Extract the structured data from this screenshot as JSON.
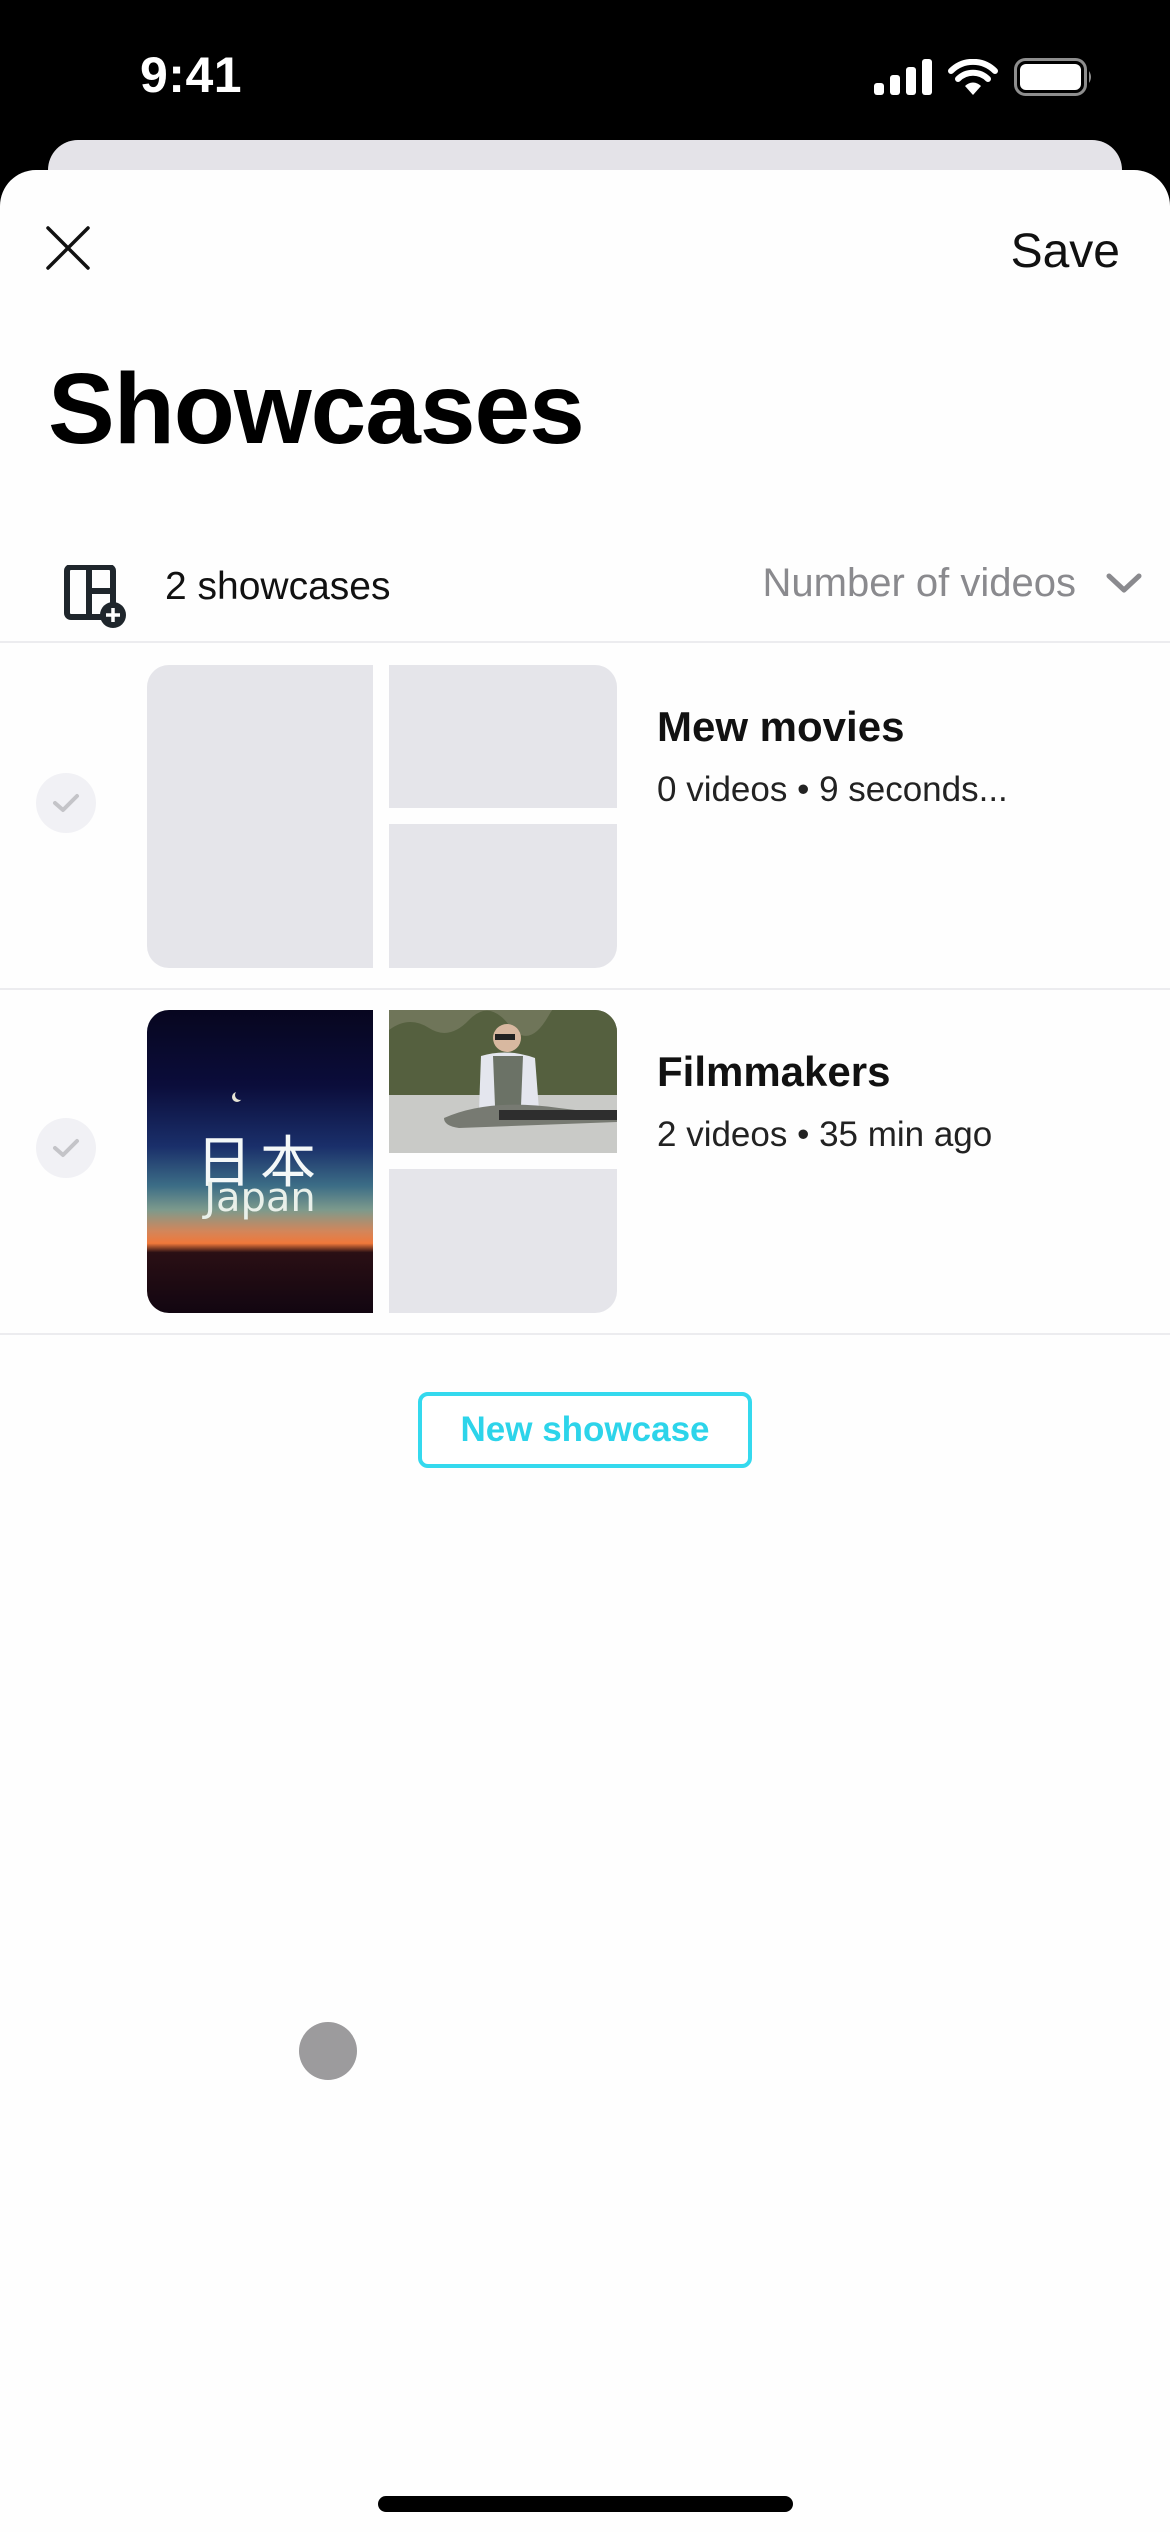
{
  "status_bar": {
    "time": "9:41",
    "icons": [
      "cellular-signal-icon",
      "wifi-icon",
      "battery-icon"
    ]
  },
  "header": {
    "close_icon": "close-icon",
    "save_label": "Save",
    "title": "Showcases"
  },
  "toolbar": {
    "count_icon": "showcase-add-icon",
    "count_label": "2 showcases",
    "sort": {
      "selected": "Number of videos",
      "icon": "chevron-down-icon"
    }
  },
  "showcases": [
    {
      "title": "Mew movies",
      "meta": "0 videos • 9 seconds...",
      "selected": false,
      "thumbnails": [
        "empty",
        "empty",
        "empty"
      ]
    },
    {
      "title": "Filmmakers",
      "meta": "2 videos • 35 min ago",
      "selected": false,
      "thumbnails": [
        "japan-sunset",
        "fisherman-with-fish",
        "empty"
      ],
      "thumbnail_text": {
        "kanji": "日本",
        "english": "Japan"
      }
    }
  ],
  "new_showcase_label": "New showcase",
  "colors": {
    "accent": "#2dd4ea",
    "placeholder": "#e5e5ea",
    "secondary_text": "#8a8a8e"
  }
}
